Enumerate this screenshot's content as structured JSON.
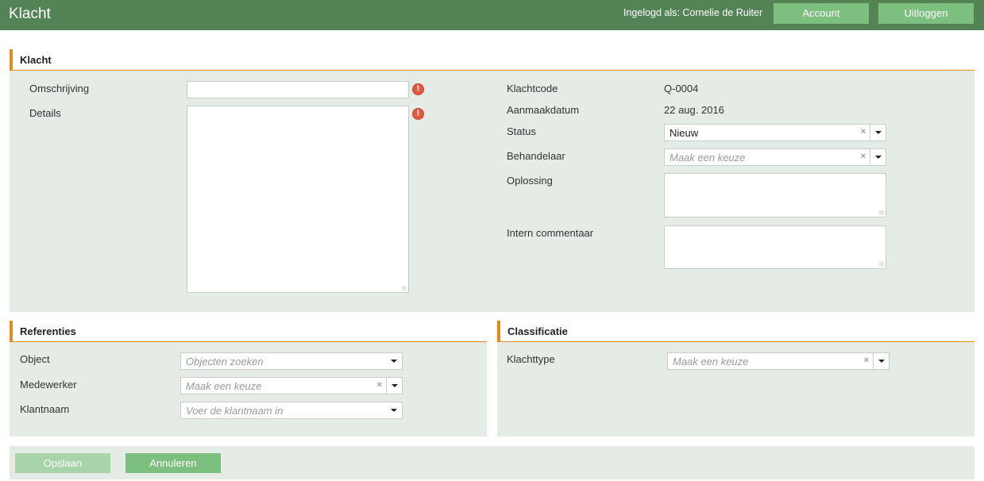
{
  "header": {
    "title": "Klacht",
    "user_label": "Ingelogd als: Cornelie de Ruiter",
    "account_label": "Account",
    "logout_label": "Uitloggen"
  },
  "klacht": {
    "section_title": "Klacht",
    "omschrijving": {
      "label": "Omschrijving",
      "value": ""
    },
    "details": {
      "label": "Details",
      "value": ""
    },
    "klachtcode": {
      "label": "Klachtcode",
      "value": "Q-0004"
    },
    "aanmaakdatum": {
      "label": "Aanmaakdatum",
      "value": "22 aug. 2016"
    },
    "status": {
      "label": "Status",
      "value": "Nieuw"
    },
    "behandelaar": {
      "label": "Behandelaar",
      "placeholder": "Maak een keuze"
    },
    "oplossing": {
      "label": "Oplossing",
      "value": ""
    },
    "intern_commentaar": {
      "label": "Intern commentaar",
      "value": ""
    },
    "error_icon": "!"
  },
  "referenties": {
    "section_title": "Referenties",
    "object": {
      "label": "Object",
      "placeholder": "Objecten zoeken"
    },
    "medewerker": {
      "label": "Medewerker",
      "placeholder": "Maak een keuze"
    },
    "klantnaam": {
      "label": "Klantnaam",
      "placeholder": "Voer de klantnaam in"
    }
  },
  "classificatie": {
    "section_title": "Classificatie",
    "klachttype": {
      "label": "Klachttype",
      "placeholder": "Maak een keuze"
    }
  },
  "footer": {
    "save_label": "Opslaan",
    "cancel_label": "Annuleren"
  },
  "icons": {
    "clear": "×"
  },
  "colors": {
    "header_bg": "#548455",
    "accent": "#e88a1a",
    "panel_bg": "#e5ebe5",
    "button_green": "#7dbf7e",
    "error": "#e5573f"
  }
}
